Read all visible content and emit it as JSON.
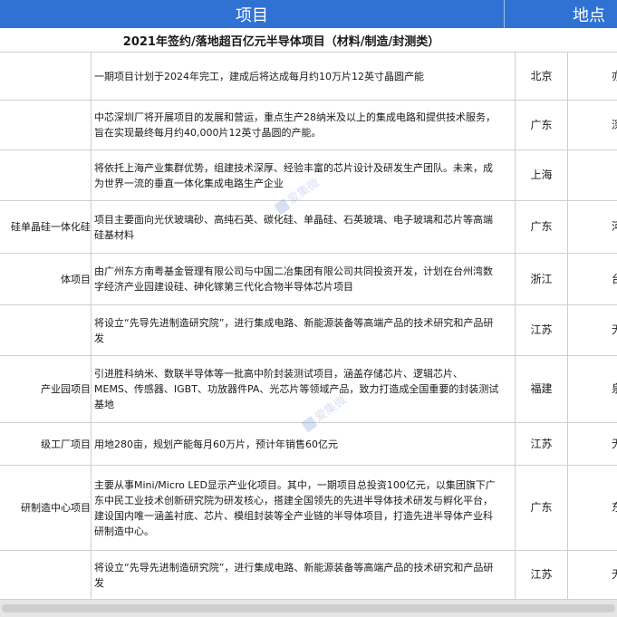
{
  "header": {
    "project": "项目",
    "location": "地点"
  },
  "subtitle": "2021年签约/落地超百亿元半导体项目（材料/制造/封测类）",
  "rows": [
    {
      "name": "",
      "desc": "一期项目计划于2024年完工，建成后将达成每月约10万片12英寸晶圆产能",
      "loc": "北京",
      "extra": "亦"
    },
    {
      "name": "",
      "desc": "中芯深圳厂将开展项目的发展和营运，重点生产28纳米及以上的集成电路和提供技术服务，旨在实现最终每月约40,000片12英寸晶圆的产能。",
      "loc": "广东",
      "extra": "深"
    },
    {
      "name": "",
      "desc": "将依托上海产业集群优势，组建技术深厚、经验丰富的芯片设计及研发生产团队。未来，成为世界一流的垂直一体化集成电路生产企业",
      "loc": "上海",
      "extra": ""
    },
    {
      "name": "硅单晶硅一体化硅",
      "desc": "项目主要面向光伏玻璃砂、高纯石英、碳化硅、单晶硅、石英玻璃、电子玻璃和芯片等高端硅基材料",
      "loc": "广东",
      "extra": "河"
    },
    {
      "name": "体项目",
      "desc": "由广州东方南粤基金管理有限公司与中国二冶集团有限公司共同投资开发，计划在台州湾数字经济产业园建设硅、砷化镓第三代化合物半导体芯片项目",
      "loc": "浙江",
      "extra": "台"
    },
    {
      "name": "",
      "desc": "将设立“先导先进制造研究院”，进行集成电路、新能源装备等高端产品的技术研究和产品研发",
      "loc": "江苏",
      "extra": "无"
    },
    {
      "name": "产业园项目",
      "desc": "引进胜科纳米、数联半导体等一批高中阶封装测试项目，涵盖存储芯片、逻辑芯片、MEMS、传感器、IGBT、功放器件PA、光芯片等领域产品，致力打造成全国重要的封装测试基地",
      "loc": "福建",
      "extra": "泉"
    },
    {
      "name": "级工厂项目",
      "desc": "用地280亩，规划产能每月60万片，预计年销售60亿元",
      "loc": "江苏",
      "extra": "无"
    },
    {
      "name": "研制造中心项目",
      "desc": "主要从事Mini/Micro LED显示产业化项目。其中，一期项目总投资100亿元，以集团旗下广东中民工业技术创新研究院为研发核心，搭建全国领先的先进半导体技术研发与孵化平台，建设国内唯一涵盖衬底、芯片、模组封装等全产业链的半导体项目，打造先进半导体产业科研制造中心。",
      "loc": "广东",
      "extra": "东"
    },
    {
      "name": "",
      "desc": "将设立“先导先进制造研究院”，进行集成电路、新能源装备等高端产品的技术研究和产品研发",
      "loc": "江苏",
      "extra": "无"
    }
  ],
  "watermark": "爱集微"
}
